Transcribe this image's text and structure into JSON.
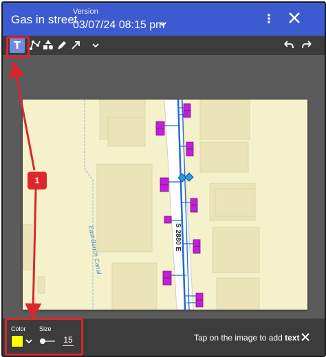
{
  "header": {
    "title": "Gas in street",
    "version_label": "Version",
    "version_value": "03/07/24 08:15 pm"
  },
  "map": {
    "street_label": "S 2880 E",
    "canal_label": "East Bench Canal"
  },
  "callout": {
    "number": "1"
  },
  "bottom": {
    "color_label": "Color",
    "size_label": "Size",
    "size_value": "15",
    "hint_prefix": "Tap on the image to add ",
    "hint_bold": "text"
  },
  "colors": {
    "header": "#3d5bd0",
    "toolbar": "#3c3c3c",
    "selected_color": "#ffff00",
    "annotation": "#d9262c"
  }
}
